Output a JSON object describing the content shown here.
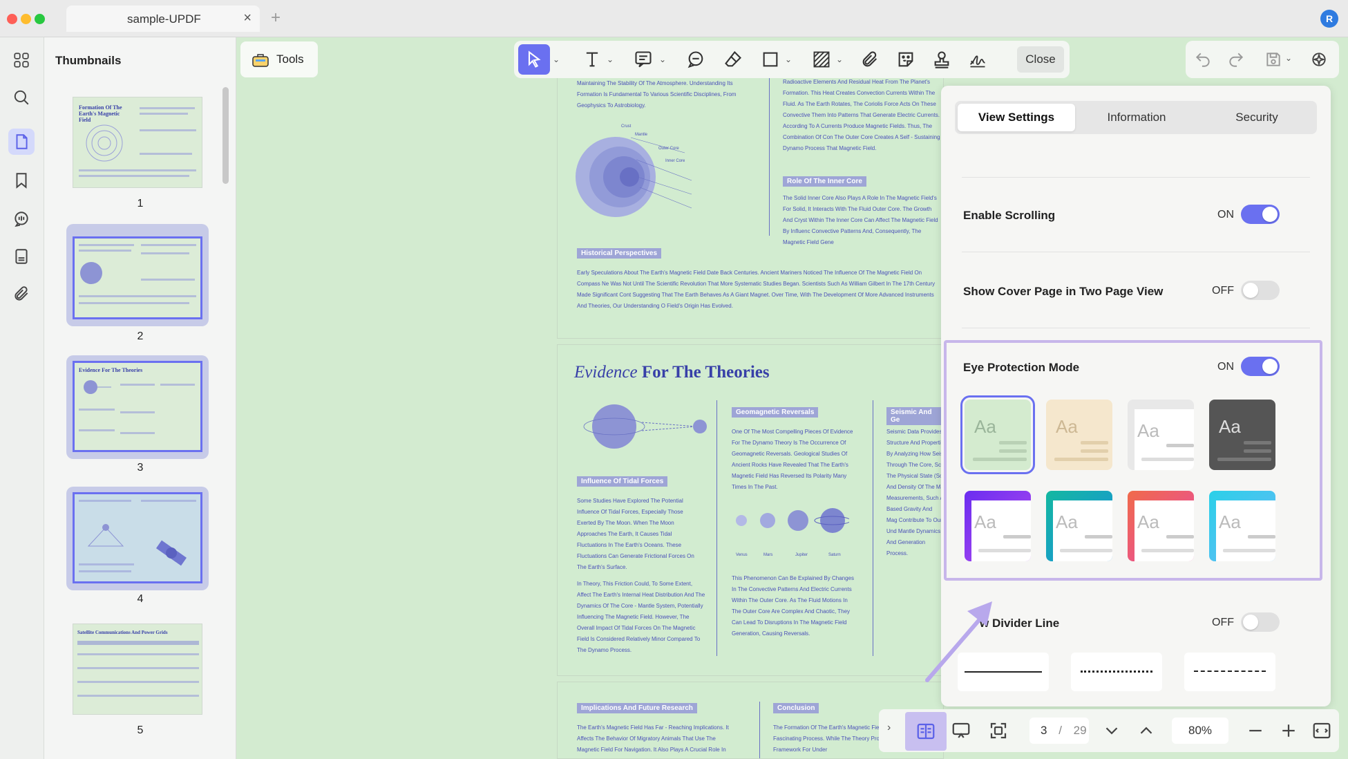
{
  "window": {
    "tab_title": "sample-UPDF",
    "avatar_initial": "R"
  },
  "thumbnails": {
    "title": "Thumbnails",
    "pages": [
      {
        "number": "1",
        "title": "Formation Of The Earth's Magnetic Field"
      },
      {
        "number": "2",
        "title": ""
      },
      {
        "number": "3",
        "title": "Evidence For The Theories"
      },
      {
        "number": "4",
        "title": ""
      },
      {
        "number": "5",
        "title": "Satellite Communications And Power Grids"
      }
    ]
  },
  "toolbar": {
    "tools_label": "Tools",
    "close_label": "Close"
  },
  "document": {
    "col1_top": "Maintaining The Stability Of The Atmosphere. Understanding Its Formation Is Fundamental To Various Scientific Disciplines, From Geophysics To Astrobiology.",
    "col2_top": "Radioactive Elements And Residual Heat From The Planet's Formation. This Heat Creates Convection Currents Within The Fluid. As The Earth Rotates, The Coriolis Force Acts On These Convective Them Into Patterns That Generate Electric Currents. According To A Currents Produce Magnetic Fields. Thus, The Combination Of Con The Outer Core Creates A Self - Sustaining Dynamo Process That Magnetic Field.",
    "earth_labels": [
      "Crust",
      "Mantle",
      "Outer Core",
      "Inner Core"
    ],
    "role_heading": "Role Of The Inner Core",
    "role_text": "The Solid Inner Core Also Plays A Role In The Magnetic Field's For Solid, It Interacts With The Fluid Outer Core. The Growth And Cryst Within The Inner Core Can Affect The Magnetic Field By Influenc Convective Patterns And, Consequently, The Magnetic Field Gene",
    "historical_heading": "Historical Perspectives",
    "historical_text": "Early Speculations About The Earth's Magnetic Field Date Back Centuries. Ancient Mariners Noticed The Influence Of The Magnetic Field On Compass Ne Was Not Until The Scientific Revolution That More Systematic Studies Began. Scientists Such As William Gilbert In The 17th Century Made Significant Cont Suggesting That The Earth Behaves As A Giant Magnet. Over Time, With The Development Of More Advanced Instruments And Theories, Our Understanding O Field's Origin Has Evolved.",
    "evidence_title_italic": "Evidence",
    "evidence_title_rest": "For The Theories",
    "tidal_heading": "Influence Of Tidal Forces",
    "tidal_text": "Some Studies Have Explored The Potential Influence Of Tidal Forces, Especially Those Exerted By The Moon. When The Moon Approaches The Earth, It Causes Tidal Fluctuations In The Earth's Oceans. These Fluctuations Can Generate Frictional Forces On The Earth's Surface.",
    "tidal_text2": "In Theory, This Friction Could, To Some Extent, Affect The Earth's Internal Heat Distribution And The Dynamics Of The Core - Mantle System, Potentially Influencing The Magnetic Field. However, The Overall Impact Of Tidal Forces On The Magnetic Field Is Considered Relatively Minor Compared To The Dynamo Process.",
    "geomag_heading": "Geomagnetic Reversals",
    "geomag_text": "One Of The Most Compelling Pieces Of Evidence For The Dynamo Theory Is The Occurrence Of Geomagnetic Reversals. Geological Studies Of Ancient Rocks Have Revealed That The Earth's Magnetic Field Has Reversed Its Polarity Many Times In The Past.",
    "geomag_text2": "This Phenomenon Can Be Explained By Changes In The Convective Patterns And Electric Currents Within The Outer Core. As The Fluid Motions In The Outer Core Are Complex And Chaotic, They Can Lead To Disruptions In The Magnetic Field Generation, Causing Reversals.",
    "planet_labels": [
      "Venus",
      "Mars",
      "Jupiter",
      "Saturn"
    ],
    "seismic_heading": "Seismic And Ge",
    "seismic_text": "Seismic Data Provides Structure And Propertie By Analyzing How Seis Through The Core, Sci The Physical State (So And Density Of The Ma Measurements, Such A Based Gravity And Mag Contribute To Our Und Mantle Dynamics And Generation Process.",
    "implications_heading": "Implications And Future Research",
    "implications_text": "The Earth's Magnetic Field Has Far - Reaching Implications. It Affects The Behavior Of Migratory Animals That Use The Magnetic Field For Navigation. It Also Plays A Crucial Role In Modern",
    "conclusion_heading": "Conclusion",
    "conclusion_text": "The Formation Of The Earth's Magnetic Field Complex And Fascinating Process. While The Theory Provides A Robust Framework For Under"
  },
  "settings": {
    "tabs": [
      "View Settings",
      "Information",
      "Security"
    ],
    "active_tab": "View Settings",
    "enable_scrolling": {
      "label": "Enable Scrolling",
      "state": "ON"
    },
    "show_cover": {
      "label": "Show Cover Page in Two Page View",
      "state": "OFF"
    },
    "eye_protection": {
      "label": "Eye Protection Mode",
      "state": "ON"
    },
    "divider_line": {
      "label": "Show Divider Line",
      "visible_label": "w Divider Line",
      "state": "OFF"
    },
    "swatch_text": "Aa",
    "themes": [
      "green",
      "beige",
      "light-gray",
      "dark-gray",
      "purple-gradient",
      "teal-gradient",
      "pink-gradient",
      "cyan-gradient"
    ],
    "selected_theme": "green"
  },
  "bottombar": {
    "current_page": "3",
    "separator": "/",
    "total_pages": "29",
    "zoom": "80%"
  },
  "colors": {
    "accent": "#6a70f0",
    "eye_green": "#d3ebd0",
    "highlight_box": "#c7b6ea"
  }
}
